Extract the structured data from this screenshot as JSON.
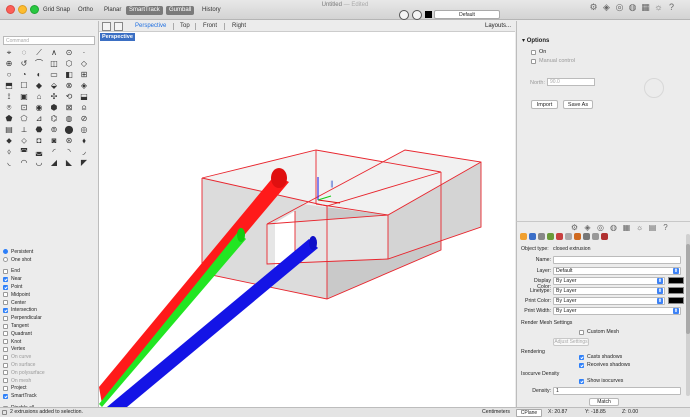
{
  "toolbar": {
    "modes": [
      {
        "label": "Grid Snap",
        "active": false
      },
      {
        "label": "Ortho",
        "active": false
      },
      {
        "label": "Planar",
        "active": false
      },
      {
        "label": "SmartTrack",
        "active": true
      },
      {
        "label": "Gumball",
        "active": true
      },
      {
        "label": "History",
        "active": false
      }
    ],
    "document_title": "Untitled",
    "document_state": "Edited",
    "layer": "Default"
  },
  "command": {
    "placeholder": "Command"
  },
  "tools": [
    "⌖",
    "◌",
    "⟋",
    "∧",
    "⊙",
    "·",
    "⊕",
    "↺",
    "⌒",
    "◫",
    "⬡",
    "◇",
    "○",
    "◔",
    "◐",
    "▭",
    "◧",
    "⊞",
    "⬒",
    "☐",
    "◆",
    "⬙",
    "⊗",
    "◈",
    "⟟",
    "▣",
    "⌂",
    "✣",
    "⟲",
    "⬓",
    "⍟",
    "⊡",
    "◉",
    "⬢",
    "⊠",
    "⍝",
    "⬟",
    "⬠",
    "⊿",
    "⌬",
    "◍",
    "⊘",
    "▤",
    "⟂",
    "⬣",
    "⊚",
    "⬤",
    "◎",
    "⬥",
    "⬦",
    "◘",
    "◙",
    "⊛",
    "⬧",
    "⬨",
    "◚",
    "◛",
    "◜",
    "◝",
    "◞",
    "◟",
    "◠",
    "◡",
    "◢",
    "◣",
    "◤"
  ],
  "osnap": {
    "persistence": [
      {
        "label": "Persistent",
        "on": true
      },
      {
        "label": "One shot",
        "on": false
      }
    ],
    "snaps": [
      {
        "label": "End",
        "on": false,
        "dim": false
      },
      {
        "label": "Near",
        "on": true,
        "dim": false
      },
      {
        "label": "Point",
        "on": true,
        "dim": false
      },
      {
        "label": "Midpoint",
        "on": false,
        "dim": false
      },
      {
        "label": "Center",
        "on": false,
        "dim": false
      },
      {
        "label": "Intersection",
        "on": true,
        "dim": false
      },
      {
        "label": "Perpendicular",
        "on": false,
        "dim": false
      },
      {
        "label": "Tangent",
        "on": false,
        "dim": false
      },
      {
        "label": "Quadrant",
        "on": false,
        "dim": false
      },
      {
        "label": "Knot",
        "on": false,
        "dim": false
      },
      {
        "label": "Vertex",
        "on": false,
        "dim": false
      },
      {
        "label": "On curve",
        "on": false,
        "dim": true
      },
      {
        "label": "On surface",
        "on": false,
        "dim": true
      },
      {
        "label": "On polysurface",
        "on": false,
        "dim": true
      },
      {
        "label": "On mesh",
        "on": false,
        "dim": true
      },
      {
        "label": "Project",
        "on": false,
        "dim": false
      },
      {
        "label": "SmartTrack",
        "on": true,
        "dim": false
      }
    ],
    "disable_all": "Disable all"
  },
  "viewport": {
    "tabs": [
      {
        "label": "Perspective",
        "active": true
      },
      {
        "label": "Top",
        "active": false
      },
      {
        "label": "Front",
        "active": false
      },
      {
        "label": "Right",
        "active": false
      }
    ],
    "layouts": "Layouts...",
    "label": "Perspective"
  },
  "sun_panel": {
    "section": "Options",
    "on_label": "On",
    "manual_label": "Manual control",
    "north_label": "North:",
    "north_value": "90.0",
    "import_label": "Import",
    "save_as_label": "Save As"
  },
  "properties": {
    "object_type_label": "Object type:",
    "object_type": "closed extrusion",
    "name_label": "Name:",
    "name_value": "",
    "layer_label": "Layer:",
    "layer_value": "Default",
    "display_color_label": "Display Color:",
    "display_color_value": "By Layer",
    "linetype_label": "Linetype:",
    "linetype_value": "By Layer",
    "print_color_label": "Print Color:",
    "print_color_value": "By Layer",
    "print_width_label": "Print Width:",
    "print_width_value": "By Layer",
    "render_mesh_section": "Render Mesh Settings",
    "custom_mesh_label": "Custom Mesh",
    "adjust_settings_label": "Adjust Settings",
    "rendering_section": "Rendering",
    "casts_shadows_label": "Casts shadows",
    "receives_shadows_label": "Receives shadows",
    "isocurve_section": "Isocurve Density",
    "show_isocurves_label": "Show isocurves",
    "density_label": "Density:",
    "density_value": "1",
    "match_label": "Match"
  },
  "status": {
    "message": "2 extrusions added to selection.",
    "units": "Centimeters",
    "cplane": "CPlane",
    "x": "X: 20.87",
    "y": "Y: -18.85",
    "z": "Z: 0.00"
  },
  "colors": {
    "accent": "#2d7ff9",
    "viewport_label": "#3b6fc3",
    "box_edge": "#e8262e",
    "axis_red": "#ff1a1a",
    "axis_green": "#22e622",
    "axis_blue": "#1414e6"
  }
}
